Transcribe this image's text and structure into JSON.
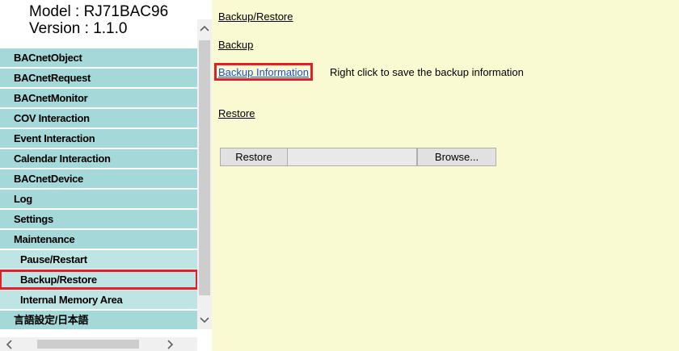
{
  "header": {
    "model_line": "Model : RJ71BAC96",
    "version_line": "Version : 1.1.0"
  },
  "menu": {
    "items": [
      {
        "label": "BACnetObject"
      },
      {
        "label": "BACnetRequest"
      },
      {
        "label": "BACnetMonitor"
      },
      {
        "label": "COV Interaction"
      },
      {
        "label": "Event Interaction"
      },
      {
        "label": "Calendar Interaction"
      },
      {
        "label": "BACnetDevice"
      },
      {
        "label": "Log"
      },
      {
        "label": "Settings"
      },
      {
        "label": "Maintenance"
      },
      {
        "label": "Pause/Restart"
      },
      {
        "label": "Backup/Restore"
      },
      {
        "label": "Internal Memory Area"
      },
      {
        "label": "言語設定/日本語"
      }
    ],
    "selected": "Backup/Restore"
  },
  "icons": {
    "scroll_up": "chevron-up-icon",
    "scroll_down": "chevron-down-icon",
    "scroll_left": "chevron-left-icon",
    "scroll_right": "chevron-right-icon"
  },
  "content": {
    "breadcrumb": "Backup/Restore",
    "backup_heading": "Backup",
    "backup_info_link": "Backup Information",
    "backup_info_hint": "Right click to save the backup information",
    "restore_heading": "Restore",
    "restore_button": "Restore",
    "browse_button": "Browse..."
  },
  "colors": {
    "menu_bg": "#a4d8d9",
    "content_bg": "#fafad2",
    "highlight": "#e3202a",
    "link": "#1a4fd6"
  }
}
